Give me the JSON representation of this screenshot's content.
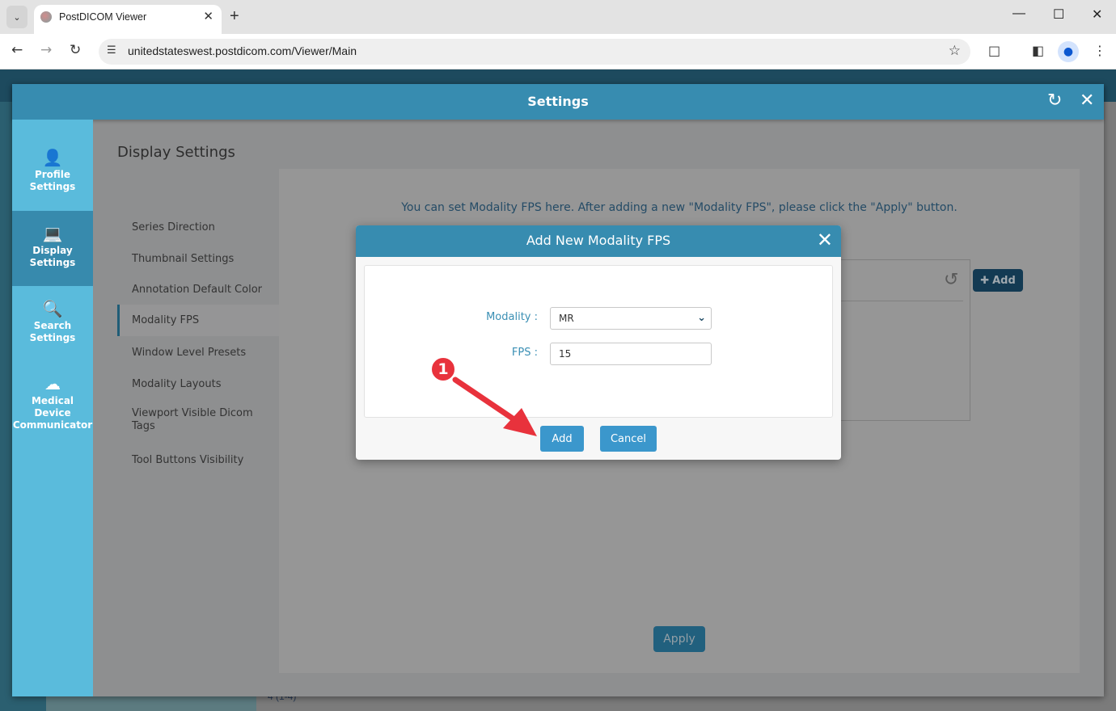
{
  "browser": {
    "tab_title": "PostDICOM Viewer",
    "url": "unitedstateswest.postdicom.com/Viewer/Main",
    "icons": [
      "tab-list-icon",
      "favicon",
      "close-tab-icon",
      "new-tab-icon",
      "minimize-icon",
      "maximize-icon",
      "close-window-icon",
      "back-icon",
      "forward-icon",
      "reload-icon",
      "site-info-icon",
      "bookmark-star-icon",
      "extensions-icon",
      "side-panel-icon",
      "profile-icon",
      "menu-icon"
    ]
  },
  "app_background": {
    "footer_text": "4 (1-4)"
  },
  "settings": {
    "title": "Settings",
    "side_nav": [
      {
        "label_line1": "Profile",
        "label_line2": "Settings",
        "icon": "person-icon",
        "active": false
      },
      {
        "label_line1": "Display",
        "label_line2": "Settings",
        "icon": "monitor-gear-icon",
        "active": true
      },
      {
        "label_line1": "Search",
        "label_line2": "Settings",
        "icon": "search-gear-icon",
        "active": false
      },
      {
        "label_line1": "Medical Device",
        "label_line2": "Communicator",
        "icon": "cloud-upload-icon",
        "active": false
      }
    ],
    "panel_title": "Display Settings",
    "sub_nav": [
      {
        "label": "Series Direction",
        "active": false
      },
      {
        "label": "Thumbnail Settings",
        "active": false
      },
      {
        "label": "Annotation Default Color",
        "active": false
      },
      {
        "label": "Modality FPS",
        "active": true
      },
      {
        "label": "Window Level Presets",
        "active": false
      },
      {
        "label": "Modality Layouts",
        "active": false
      },
      {
        "label": "Viewport Visible Dicom Tags",
        "active": false
      },
      {
        "label": "Tool Buttons Visibility",
        "active": false
      }
    ],
    "info_text": "You can set Modality FPS here. After adding a new \"Modality FPS\", please click the \"Apply\" button.",
    "add_button": "Add",
    "apply_button": "Apply"
  },
  "modal": {
    "title": "Add New Modality FPS",
    "modality_label": "Modality :",
    "modality_value": "MR",
    "fps_label": "FPS :",
    "fps_value": "15",
    "add_button": "Add",
    "cancel_button": "Cancel"
  },
  "annotation": {
    "step_number": "1",
    "color": "#e8323c"
  }
}
